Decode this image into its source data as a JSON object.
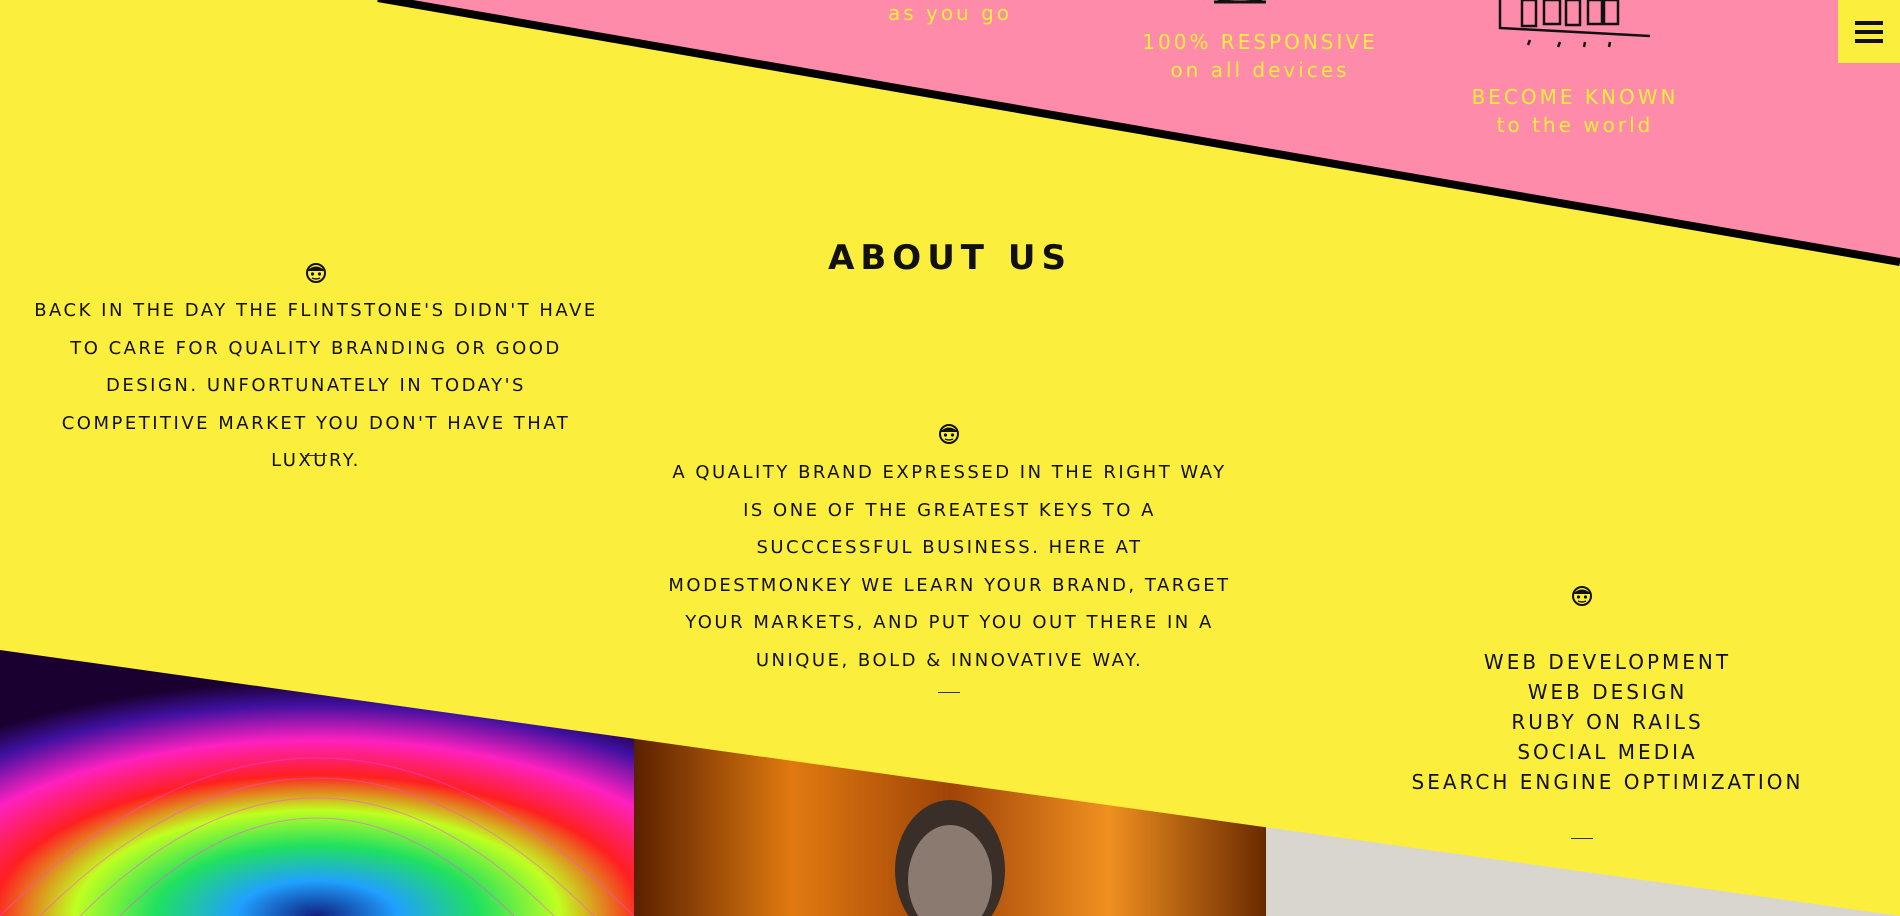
{
  "features": [
    {
      "line1": "",
      "line2": "as you go"
    },
    {
      "line1": "100% RESPONSIVE",
      "line2": "on all devices"
    },
    {
      "line1": "BECOME KNOWN",
      "line2": "to the world"
    }
  ],
  "about": {
    "title": "ABOUT US",
    "left_text": "BACK IN THE DAY THE FLINTSTONE'S DIDN'T HAVE TO CARE FOR QUALITY BRANDING OR GOOD DESIGN. UNFORTUNATELY IN TODAY'S COMPETITIVE MARKET YOU DON'T HAVE THAT LUXURY.",
    "center_text": "A QUALITY BRAND EXPRESSED IN THE RIGHT WAY IS ONE OF THE GREATEST KEYS TO A SUCCCESSFUL BUSINESS. HERE AT MODESTMONKEY WE LEARN YOUR BRAND, TARGET YOUR MARKETS, AND PUT YOU OUT THERE IN A UNIQUE, BOLD & INNOVATIVE WAY.",
    "services": [
      "WEB DEVELOPMENT",
      "WEB DESIGN",
      "RUBY ON RAILS",
      "SOCIAL MEDIA",
      "SEARCH ENGINE OPTIMIZATION"
    ]
  },
  "icons": {
    "menu": "hamburger-menu-icon",
    "monkey": "monkey-icon"
  },
  "colors": {
    "background": "#fcee3c",
    "pink_band": "#fe8ba9",
    "text": "#111111",
    "feature_text": "#fcee3c"
  }
}
